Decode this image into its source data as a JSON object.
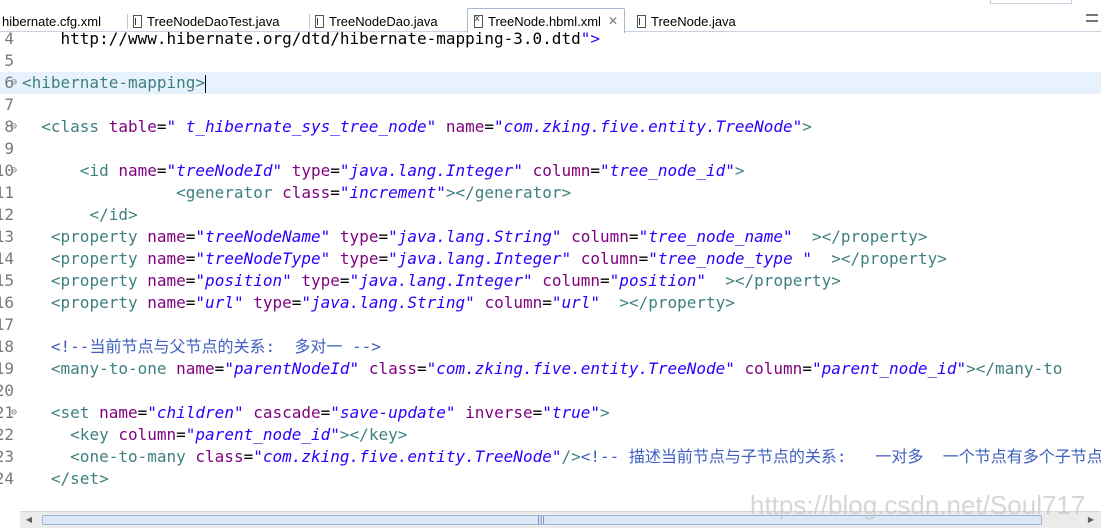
{
  "tabs": [
    {
      "label": "hibernate.cfg.xml",
      "icon": "xml-file-icon",
      "active": false
    },
    {
      "label": "TreeNodeDaoTest.java",
      "icon": "java-file-icon",
      "active": false
    },
    {
      "label": "TreeNodeDao.java",
      "icon": "java-file-icon",
      "active": false
    },
    {
      "label": "TreeNode.hbml.xml",
      "icon": "xml-file-icon",
      "active": true,
      "close_label": "✕"
    },
    {
      "label": "TreeNode.java",
      "icon": "java-file-icon",
      "active": false
    }
  ],
  "editor": {
    "current_line": "6",
    "lines": [
      {
        "n": "4",
        "text": "    http://www.hibernate.org/dtd/hibernate-mapping-3.0.dtd\">"
      },
      {
        "n": "5",
        "text": ""
      },
      {
        "n": "6",
        "text": "<hibernate-mapping>"
      },
      {
        "n": "7",
        "text": ""
      },
      {
        "n": "8",
        "text": "  <class table=\" t_hibernate_sys_tree_node\" name=\"com.zking.five.entity.TreeNode\">"
      },
      {
        "n": "9",
        "text": ""
      },
      {
        "n": "10",
        "text": "      <id name=\"treeNodeId\" type=\"java.lang.Integer\" column=\"tree_node_id\">"
      },
      {
        "n": "11",
        "text": "                <generator class=\"increment\"></generator>"
      },
      {
        "n": "12",
        "text": "       </id>"
      },
      {
        "n": "13",
        "text": "   <property name=\"treeNodeName\" type=\"java.lang.String\" column=\"tree_node_name\"  ></property>"
      },
      {
        "n": "14",
        "text": "   <property name=\"treeNodeType\" type=\"java.lang.Integer\" column=\"tree_node_type \"  ></property>"
      },
      {
        "n": "15",
        "text": "   <property name=\"position\" type=\"java.lang.Integer\" column=\"position\"  ></property>"
      },
      {
        "n": "16",
        "text": "   <property name=\"url\" type=\"java.lang.String\" column=\"url\"  ></property>"
      },
      {
        "n": "17",
        "text": ""
      },
      {
        "n": "18",
        "text": "   <!--当前节点与父节点的关系:  多对一 -->"
      },
      {
        "n": "19",
        "text": "   <many-to-one name=\"parentNodeId\" class=\"com.zking.five.entity.TreeNode\" column=\"parent_node_id\"></many-to"
      },
      {
        "n": "20",
        "text": ""
      },
      {
        "n": "21",
        "text": "   <set name=\"children\" cascade=\"save-update\" inverse=\"true\">"
      },
      {
        "n": "22",
        "text": "     <key column=\"parent_node_id\"></key>"
      },
      {
        "n": "23",
        "text": "     <one-to-many class=\"com.zking.five.entity.TreeNode\"/><!-- 描述当前节点与子节点的关系:   一对多  一个节点有多个子节点 -"
      },
      {
        "n": "24",
        "text": "   </set>"
      }
    ]
  },
  "watermark": "https://blog.csdn.net/Soul717",
  "colors": {
    "tag": "#3f7f7f",
    "attribute": "#7f007f",
    "value": "#2a00ff",
    "comment": "#3f5fbf",
    "line_number": "#787878",
    "current_line_bg": "#e8f2fe"
  }
}
